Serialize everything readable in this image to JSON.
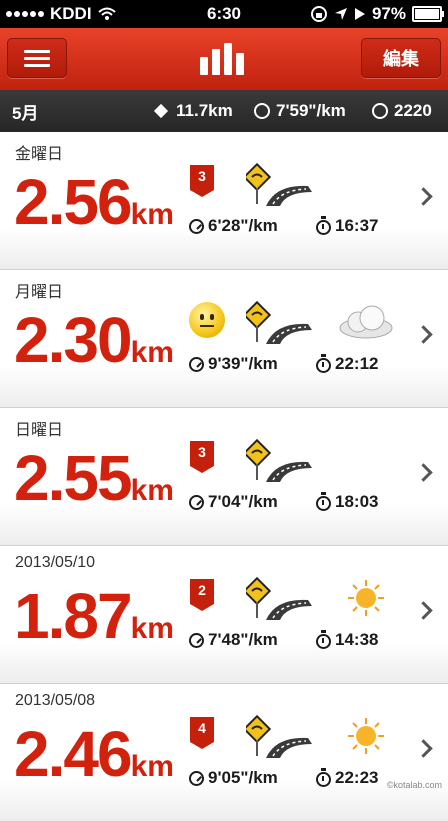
{
  "status_bar": {
    "carrier": "KDDI",
    "time": "6:30",
    "battery": "97%"
  },
  "nav": {
    "edit_label": "編集",
    "menu_icon": "hamburger-icon",
    "chart_icon": "bar-chart-icon"
  },
  "summary": {
    "month": "5月",
    "distance": "11.7km",
    "pace": "7'59\"/km",
    "calories": "2220"
  },
  "runs": [
    {
      "date": "金曜日",
      "distance": "2.56",
      "unit": "km",
      "badge": "3",
      "mood": "",
      "weather": "",
      "pace": "6'28\"/km",
      "duration": "16:37"
    },
    {
      "date": "月曜日",
      "distance": "2.30",
      "unit": "km",
      "badge": "",
      "mood": "neutral-face-icon",
      "weather": "cloud-icon",
      "pace": "9'39\"/km",
      "duration": "22:12"
    },
    {
      "date": "日曜日",
      "distance": "2.55",
      "unit": "km",
      "badge": "3",
      "mood": "",
      "weather": "",
      "pace": "7'04\"/km",
      "duration": "18:03"
    },
    {
      "date": "2013/05/10",
      "distance": "1.87",
      "unit": "km",
      "badge": "2",
      "mood": "",
      "weather": "sun-icon",
      "pace": "7'48\"/km",
      "duration": "14:38"
    },
    {
      "date": "2013/05/08",
      "distance": "2.46",
      "unit": "km",
      "badge": "4",
      "mood": "",
      "weather": "sun-icon",
      "pace": "9'05\"/km",
      "duration": "22:23"
    }
  ],
  "watermark": "©kotalab.com",
  "colors": {
    "accent": "#d2220e",
    "nav": "#c0220f",
    "summary_bar": "#2d2d2d"
  }
}
